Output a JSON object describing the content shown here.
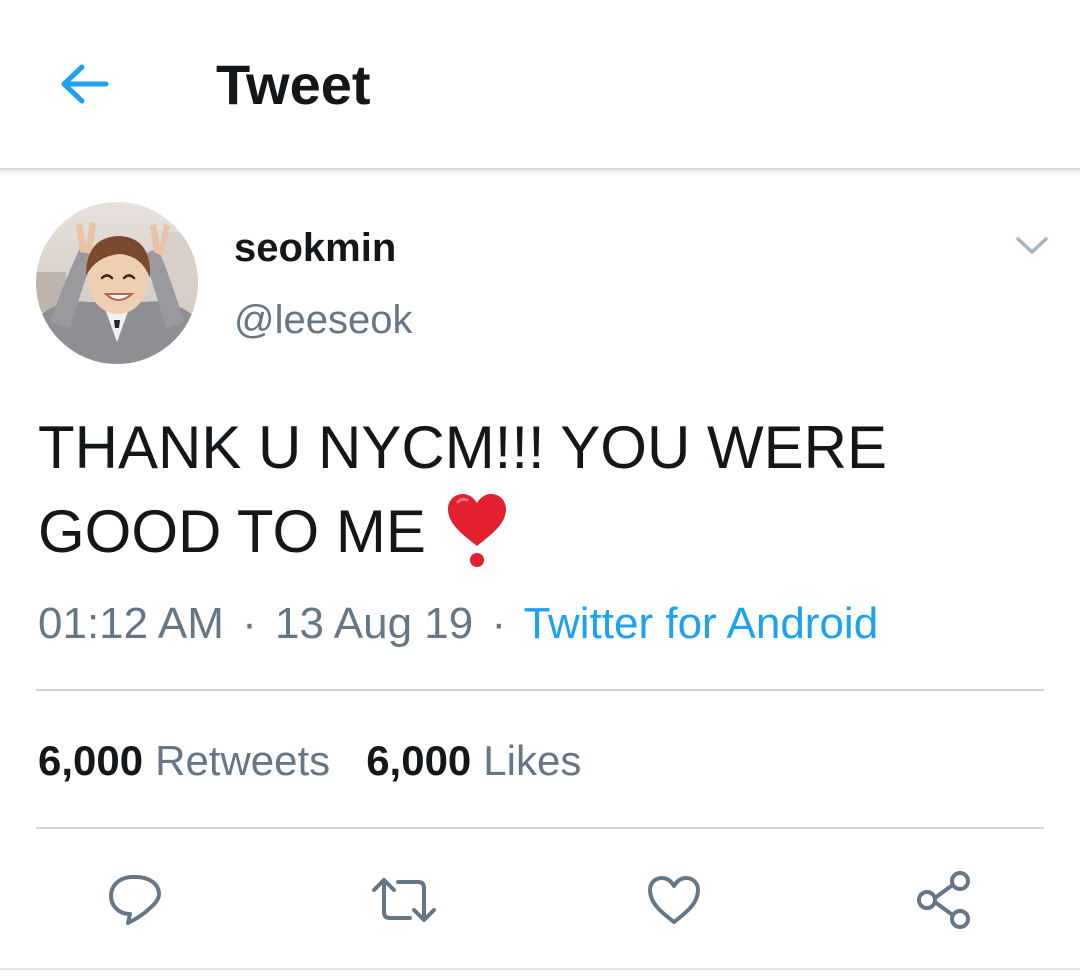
{
  "header": {
    "title": "Tweet",
    "back_icon": "arrow-left-icon",
    "accent_color": "#1da1f2"
  },
  "tweet": {
    "author": {
      "display_name": "seokmin",
      "handle": "@leeseok"
    },
    "text_line1": "THANK U NYCM!!! YOU WERE",
    "text_line2": "GOOD TO ME",
    "emoji": "heart-exclamation-icon",
    "time": "01:12 AM",
    "separator": "·",
    "date": "13 Aug 19",
    "source": "Twitter for Android"
  },
  "stats": {
    "retweets_count": "6,000",
    "retweets_label": "Retweets",
    "likes_count": "6,000",
    "likes_label": "Likes"
  },
  "actions": {
    "reply_icon": "reply-bubble-icon",
    "retweet_icon": "retweet-icon",
    "like_icon": "heart-outline-icon",
    "share_icon": "share-icon"
  },
  "colors": {
    "text_primary": "#14171a",
    "text_secondary": "#657786",
    "link": "#1da1f2",
    "divider": "#ccd6dd",
    "icon_gray": "#657786"
  }
}
